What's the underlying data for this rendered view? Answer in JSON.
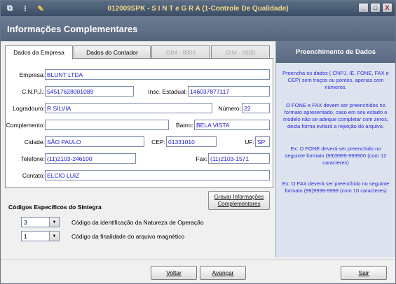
{
  "window": {
    "title": "012009SPK - S I N T e G R A (1-Controle De Qualidade)",
    "buttons": {
      "minimize": "_",
      "maximize": "□",
      "close": "X"
    }
  },
  "header": {
    "title": "Informações Complementares"
  },
  "tabs": [
    {
      "label": "Dados da Empresa",
      "state": "active"
    },
    {
      "label": "Dados do Contador",
      "state": "normal"
    },
    {
      "label": "GIM - 8806",
      "state": "disabled"
    },
    {
      "label": "GIM - 8830",
      "state": "disabled"
    }
  ],
  "form": {
    "empresa": {
      "label": "Empresa:",
      "value": "BLUNT LTDA"
    },
    "cnpj": {
      "label": "C.N.P.J.:",
      "value": "54517628001089"
    },
    "insc_estadual": {
      "label": "Insc. Estadual:",
      "value": "146037877117"
    },
    "logradouro": {
      "label": "Logradouro:",
      "value": "R SÍLVIA"
    },
    "numero": {
      "label": "Número:",
      "value": "22"
    },
    "complemento": {
      "label": "Complemento:",
      "value": ""
    },
    "bairro": {
      "label": "Bairro:",
      "value": "BELA VISTA"
    },
    "cidade": {
      "label": "Cidade:",
      "value": "SÃO PAULO"
    },
    "cep": {
      "label": "CEP:",
      "value": "01331010"
    },
    "uf": {
      "label": "UF:",
      "value": "SP"
    },
    "telefone": {
      "label": "Telefone:",
      "value": "(11)2103-246100"
    },
    "fax": {
      "label": "Fax:",
      "value": "(11)2103-1571"
    },
    "contato": {
      "label": "Contato:",
      "value": "ELCIO LUIZ"
    }
  },
  "gravar_button": {
    "line1": "Gravar Informações",
    "line2": "Complementares"
  },
  "codes_section": {
    "title": "Códigos Específicos do Sintegra",
    "natureza": {
      "value": "3",
      "label": "Código da identificação da Natureza de Operação"
    },
    "finalidade": {
      "value": "1",
      "label": "Código da finalidade do arquivo magnético"
    }
  },
  "info_panel": {
    "title": "Preenchimento de Dados",
    "paragraphs": [
      "Preencha os dados ( CNPJ, IE, FONE, FAX e CEP) sem traços ou pontos, apenas com números.",
      "O FONE e FAX  devem ser preenchidos no formato apresentado, caso em seu estado o modelo não se adeque completar com zeros, desta forma evitará a rejeição do arquivo.",
      "Ex: O FONE deverá ser preenchido no seguinte formato (99)9999-999900 (com 12 caracteres)",
      "Ex: O FAX deverá ser preenchido no seguinte formato (99)9999-9999  (com 10 caracteres)"
    ]
  },
  "bottom_buttons": {
    "voltar": "Voltar",
    "avancar": "Avançar",
    "sair": "Sair"
  }
}
